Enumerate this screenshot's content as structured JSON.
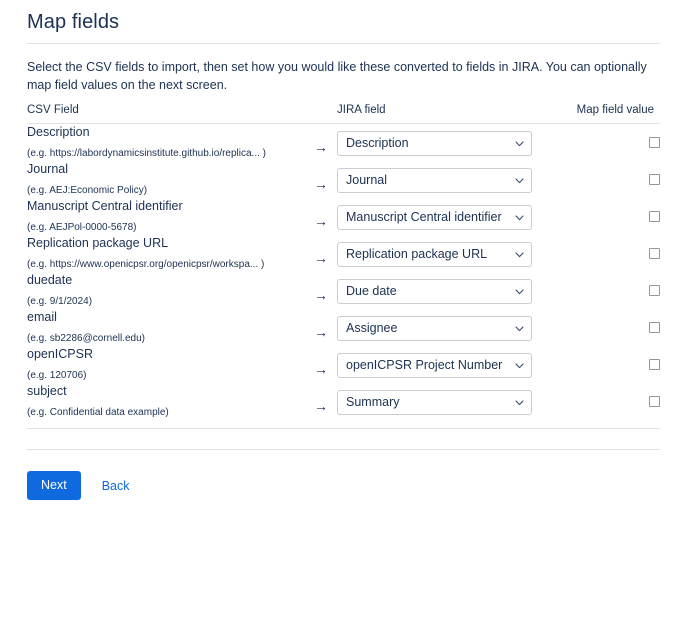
{
  "page": {
    "title": "Map fields",
    "intro": "Select the CSV fields to import, then set how you would like these converted to fields in JIRA. You can optionally map field values on the next screen."
  },
  "table": {
    "headers": {
      "csv_field": "CSV Field",
      "jira_field": "JIRA field",
      "map_field_value": "Map field value"
    },
    "arrow_glyph": "→",
    "rows": [
      {
        "csv_name": "Description",
        "csv_example": "(e.g. https://labordynamicsinstitute.github.io/replica... )",
        "jira_value": "Description",
        "map_checked": false
      },
      {
        "csv_name": "Journal",
        "csv_example": "(e.g. AEJ:Economic Policy)",
        "jira_value": "Journal",
        "map_checked": false
      },
      {
        "csv_name": "Manuscript Central identifier",
        "csv_example": "(e.g. AEJPol-0000-5678)",
        "jira_value": "Manuscript Central identifier",
        "map_checked": false
      },
      {
        "csv_name": "Replication package URL",
        "csv_example": "(e.g. https://www.openicpsr.org/openicpsr/workspa... )",
        "jira_value": "Replication package URL",
        "map_checked": false
      },
      {
        "csv_name": "duedate",
        "csv_example": "(e.g. 9/1/2024)",
        "jira_value": "Due date",
        "map_checked": false
      },
      {
        "csv_name": "email",
        "csv_example": "(e.g. sb2286@cornell.edu)",
        "jira_value": "Assignee",
        "map_checked": false
      },
      {
        "csv_name": "openICPSR",
        "csv_example": "(e.g. 120706)",
        "jira_value": "openICPSR Project Number",
        "map_checked": false
      },
      {
        "csv_name": "subject",
        "csv_example": "(e.g. Confidential data example)",
        "jira_value": "Summary",
        "map_checked": false
      }
    ]
  },
  "footer": {
    "next_label": "Next",
    "back_label": "Back"
  },
  "colors": {
    "accent": "#0f6ae0",
    "text": "#1c3152",
    "divider": "#dfe1e6",
    "field_border": "#c9ccd3"
  }
}
